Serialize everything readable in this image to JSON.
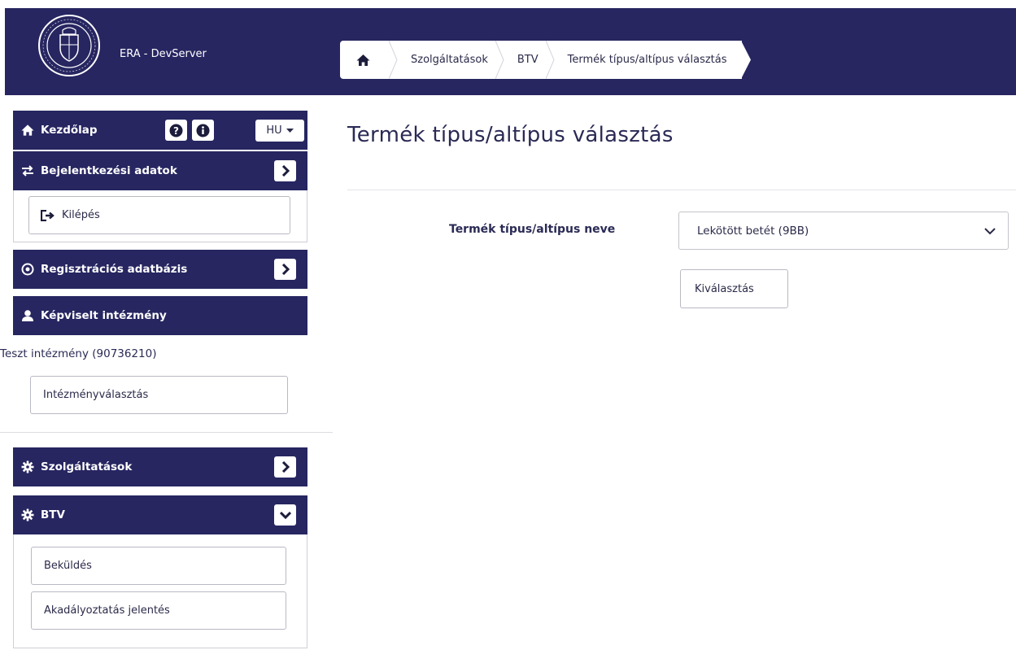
{
  "header": {
    "brand": "ERA - DevServer",
    "breadcrumb": [
      "Szolgáltatások",
      "BTV",
      "Termék típus/altípus választás"
    ]
  },
  "sidebar": {
    "home_label": "Kezdőlap",
    "language": "HU",
    "login_section": "Bejelentkezési adatok",
    "logout_label": "Kilépés",
    "registry_section": "Regisztrációs adatbázis",
    "institution_section": "Képviselt intézmény",
    "institution_name": "Teszt intézmény (90736210)",
    "institution_select": "Intézményválasztás",
    "services_section": "Szolgáltatások",
    "btv_section": "BTV",
    "btv_items": [
      "Beküldés",
      "Akadályoztatás jelentés"
    ]
  },
  "main": {
    "title": "Termék típus/altípus választás",
    "field_label": "Termék típus/altípus neve",
    "select_value": "Lekötött betét (9BB)",
    "submit_label": "Kiválasztás"
  },
  "colors": {
    "navy": "#272661",
    "text": "#2a2a55"
  }
}
